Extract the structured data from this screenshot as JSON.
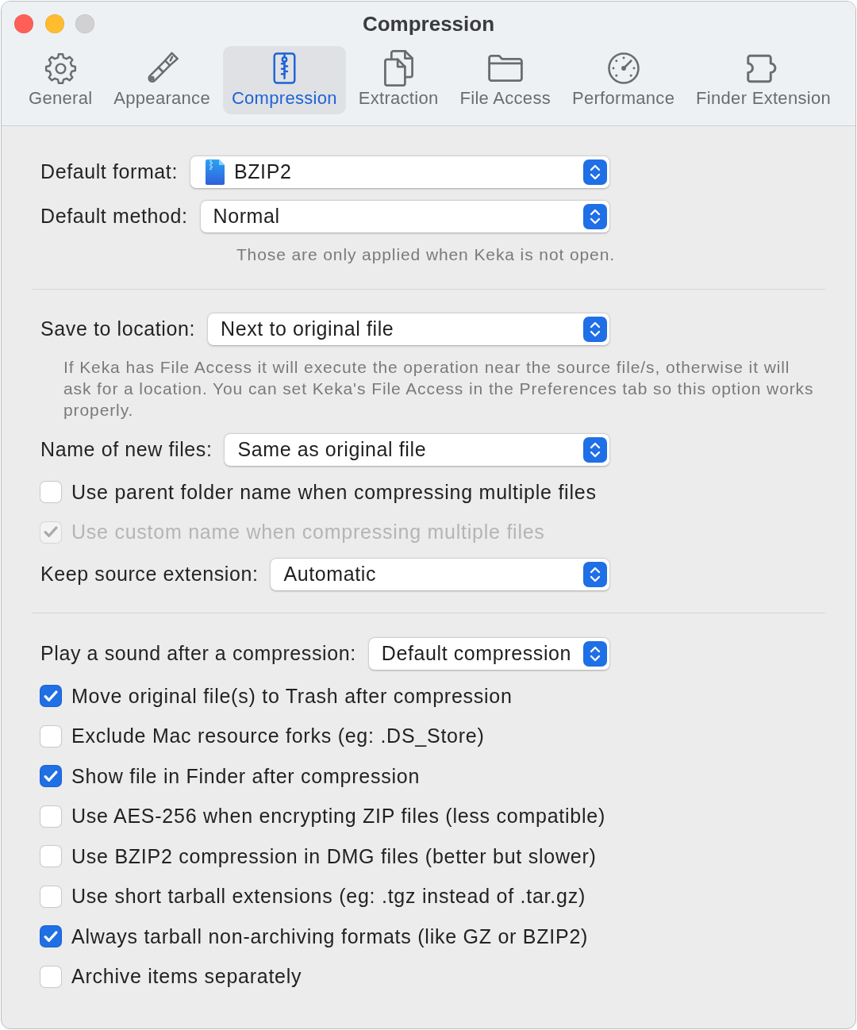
{
  "window": {
    "title": "Compression",
    "buttons": [
      {
        "kind": "close",
        "disabled": false
      },
      {
        "kind": "minimize",
        "disabled": false
      },
      {
        "kind": "zoom",
        "disabled": true
      }
    ]
  },
  "tabs": [
    {
      "label": "General",
      "selected": false
    },
    {
      "label": "Appearance",
      "selected": false
    },
    {
      "label": "Compression",
      "selected": true
    },
    {
      "label": "Extraction",
      "selected": false
    },
    {
      "label": "File Access",
      "selected": false
    },
    {
      "label": "Performance",
      "selected": false
    },
    {
      "label": "Finder Extension",
      "selected": false
    }
  ],
  "sections": [
    {
      "rows": [
        {
          "kind": "icon-select",
          "label": "Default format:",
          "value": "BZIP2"
        },
        {
          "kind": "select",
          "label": "Default method:",
          "value": "Normal"
        },
        {
          "kind": "hint",
          "text": "Those are only applied when Keka is not open."
        }
      ]
    },
    {
      "rows": [
        {
          "kind": "select",
          "label": "Save to location:",
          "value": "Next to original file"
        },
        {
          "kind": "description",
          "text": "If Keka has File Access it will execute the operation near the source file/s, otherwise it will ask for a location. You can set Keka's File Access in the Preferences tab so this option works properly."
        },
        {
          "kind": "select",
          "label": "Name of new files:",
          "value": "Same as original file"
        },
        {
          "kind": "checkbox",
          "label": "Use parent folder name when compressing multiple files",
          "checked": false,
          "disabled": false
        },
        {
          "kind": "checkbox",
          "label": "Use custom name when compressing multiple files",
          "checked": true,
          "disabled": true
        },
        {
          "kind": "select",
          "label": "Keep source extension:",
          "value": "Automatic"
        }
      ]
    },
    {
      "rows": [
        {
          "kind": "select",
          "label": "Play a sound after a compression:",
          "value": "Default compression"
        },
        {
          "kind": "checkbox",
          "label": "Move original file(s) to Trash after compression",
          "checked": true,
          "disabled": false
        },
        {
          "kind": "checkbox",
          "label": "Exclude Mac resource forks (eg: .DS_Store)",
          "checked": false,
          "disabled": false
        },
        {
          "kind": "checkbox",
          "label": "Show file in Finder after compression",
          "checked": true,
          "disabled": false
        },
        {
          "kind": "checkbox",
          "label": "Use AES-256 when encrypting ZIP files (less compatible)",
          "checked": false,
          "disabled": false
        },
        {
          "kind": "checkbox",
          "label": "Use BZIP2 compression in DMG files (better but slower)",
          "checked": false,
          "disabled": false
        },
        {
          "kind": "checkbox",
          "label": "Use short tarball extensions (eg: .tgz instead of .tar.gz)",
          "checked": false,
          "disabled": false
        },
        {
          "kind": "checkbox",
          "label": "Always tarball non-archiving formats (like GZ or BZIP2)",
          "checked": true,
          "disabled": false
        },
        {
          "kind": "checkbox",
          "label": "Archive items separately",
          "checked": false,
          "disabled": false
        }
      ]
    }
  ]
}
